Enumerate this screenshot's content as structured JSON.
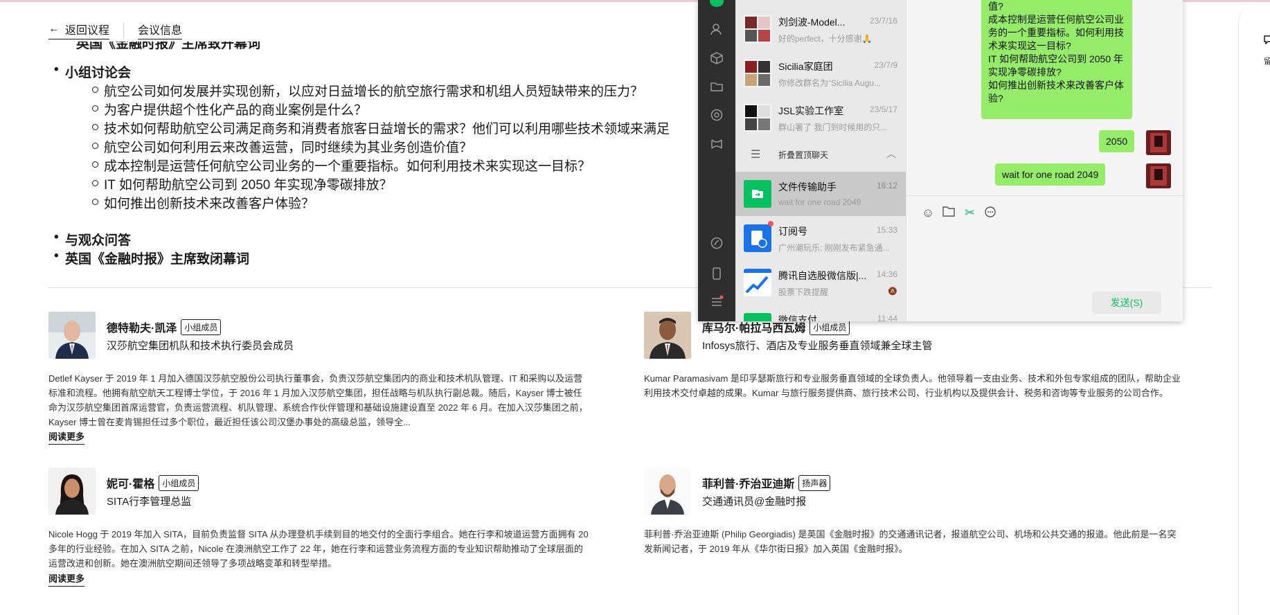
{
  "nav": {
    "back_label": "返回议程",
    "meeting_info_label": "会议信息"
  },
  "agenda": {
    "cut_line": "英国《金融时报》主席致开幕词",
    "panel_title": "小组讨论会",
    "questions": [
      "航空公司如何发展并实现创新，以应对日益增长的航空旅行需求和机组人员短缺带来的压力？",
      "为客户提供超个性化产品的商业案例是什么？",
      "技术如何帮助航空公司满足商务和消费者旅客日益增长的需求？他们可以利用哪些技术领域来满足",
      "航空公司如何利用云来改善运营，同时继续为其业务创造价值？",
      "成本控制是运营任何航空公司业务的一个重要指标。如何利用技术来实现这一目标？",
      "IT 如何帮助航空公司到 2050 年实现净零碳排放？",
      "如何推出创新技术来改善客户体验？"
    ],
    "qa": "与观众问答",
    "closing": "英国《金融时报》主席致闭幕词"
  },
  "speakers": [
    {
      "name": "德特勒夫·凯泽",
      "badge": "小组成员",
      "role": "汉莎航空集团机队和技术执行委员会成员",
      "bio": "Detlef Kayser 于 2019 年 1 月加入德国汉莎航空股份公司执行董事会，负责汉莎航空集团内的商业和技术机队管理、IT 和采购以及运营标准和流程。他拥有航空航天工程博士学位，于 2016 年 1 月加入汉莎航空集团，担任战略与机队执行副总裁。随后，Kayser 博士被任命为汉莎航空集团首席运营官，负责运营流程、机队管理、系统合作伙伴管理和基础设施建设直至 2022 年 6 月。在加入汉莎集团之前，Kayser 博士曾在麦肯锡担任过多个职位，最近担任该公司汉堡办事处的高级总监，领导全...",
      "read_more": "阅读更多"
    },
    {
      "name": "库马尔·帕拉马西瓦姆",
      "badge": "小组成员",
      "role": "Infosys旅行、酒店及专业服务垂直领域兼全球主管",
      "bio": "Kumar Paramasivam 是印孚瑟斯旅行和专业服务垂直领域的全球负责人。他领导着一支由业务、技术和外包专家组成的团队，帮助企业利用技术交付卓越的成果。Kumar 与旅行服务提供商、旅行技术公司、行业机构以及提供会计、税务和咨询等专业服务的公司合作。"
    },
    {
      "name": "妮可·霍格",
      "badge": "小组成员",
      "role": "SITA行李管理总监",
      "bio": "Nicole Hogg 于 2019 年加入 SITA，目前负责监督 SITA 从办理登机手续到目的地交付的全面行李组合。她在行李和坡道运营方面拥有 20 多年的行业经验。在加入 SITA 之前，Nicole 在澳洲航空工作了 22 年，她在行李和运营业务流程方面的专业知识帮助推动了全球层面的运营改进和创新。她在澳洲航空期间还领导了多项战略变革和转型举措。",
      "read_more": "阅读更多"
    },
    {
      "name": "菲利普·乔治亚迪斯",
      "badge": "扬声器",
      "role": "交通通讯员@金融时报",
      "bio": "菲利普·乔治亚迪斯 (Philip Georgiadis) 是英国《金融时报》的交通通讯记者，报道航空公司、机场和公共交通的报道。他此前是一名突发新闻记者，于 2019 年从《华尔街日报》加入英国《金融时报》。"
    }
  ],
  "right_edge_glyph": "留",
  "wechat": {
    "chats": [
      {
        "name": "刘剑波-Model...",
        "time": "23/7/16",
        "msg": "好的perfect，十分感谢🙏"
      },
      {
        "name": "Sicilia家庭团",
        "time": "23/7/9",
        "msg": "你修改群名为“Sicilia Augu..."
      },
      {
        "name": "JSL实验工作室",
        "time": "23/5/17",
        "msg": "群山署了 我门到时候用的只..."
      },
      {
        "name": "文件传输助手",
        "time": "16:12",
        "msg": "wait for one road 2049"
      },
      {
        "name": "订阅号",
        "time": "15:33",
        "msg": "广州潮玩乐: 刚刚发布紧急通..."
      },
      {
        "name": "腾讯自选股微信版|...",
        "time": "14:36",
        "msg": "股票下跌提醒"
      },
      {
        "name": "微信支付",
        "time": "11:44",
        "msg": ""
      }
    ],
    "fold_label": "折叠置顶聊天",
    "big_message": "值?\n成本控制是运营任何航空公司业务的一个重要指标。如何利用技术来实现这一目标?\nIT 如何帮助航空公司到 2050 年实现净零碳排放?\n如何推出创新技术来改善客户体验?",
    "msg1": "2050",
    "msg2": "wait for one road 2049",
    "send_label": "发送(S)",
    "colors": {
      "bubble": "#95ec69",
      "send_text": "#07c160",
      "sidebar": "#2e2e2e"
    }
  }
}
